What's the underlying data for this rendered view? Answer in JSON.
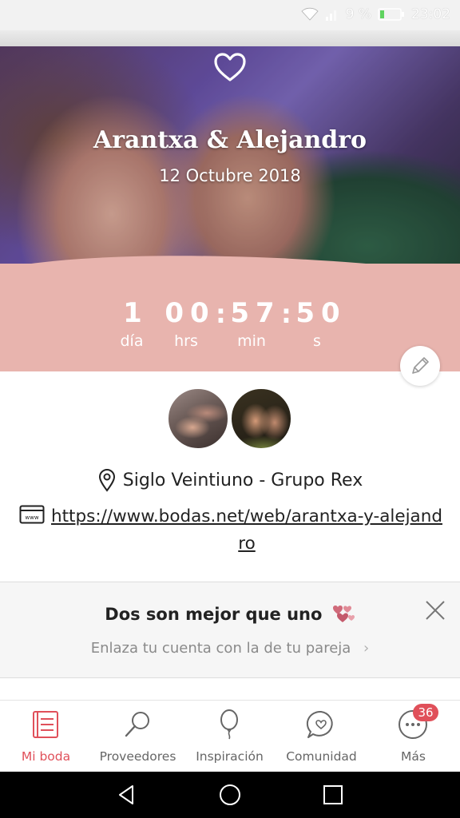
{
  "status_bar": {
    "battery_percent": "9 %",
    "time": "23:02",
    "icons": [
      "wifi-icon",
      "signal-icon",
      "battery-icon"
    ]
  },
  "hero": {
    "couple_names": "Arantxa & Alejandro",
    "date": "12 Octubre 2018",
    "icon": "heart-icon"
  },
  "countdown": {
    "days": "1",
    "hours": "00",
    "minutes": "57",
    "seconds": "50",
    "days_label": "día",
    "hours_label": "hrs",
    "minutes_label": "min",
    "seconds_label": "s",
    "separator": ":"
  },
  "venue": {
    "name": "Siglo Veintiuno - Grupo Rex",
    "icon": "location-pin-icon"
  },
  "website": {
    "url": "https://www.bodas.net/web/arantxa-y-alejandro",
    "icon": "website-icon"
  },
  "partner_card": {
    "title": "Dos son mejor que uno",
    "subtitle": "Enlaza tu cuenta con la de tu pareja",
    "chevron": "›"
  },
  "tabs": [
    {
      "label": "Mi boda",
      "icon": "wedding-planner-icon",
      "active": true
    },
    {
      "label": "Proveedores",
      "icon": "search-icon",
      "active": false
    },
    {
      "label": "Inspiración",
      "icon": "balloon-icon",
      "active": false
    },
    {
      "label": "Comunidad",
      "icon": "chat-heart-icon",
      "active": false
    },
    {
      "label": "Más",
      "icon": "more-icon",
      "active": false
    }
  ],
  "more_badge": "36",
  "colors": {
    "accent": "#e0505a",
    "countdown_bg": "#e8b4ae",
    "card_bg": "#f6f6f6"
  }
}
